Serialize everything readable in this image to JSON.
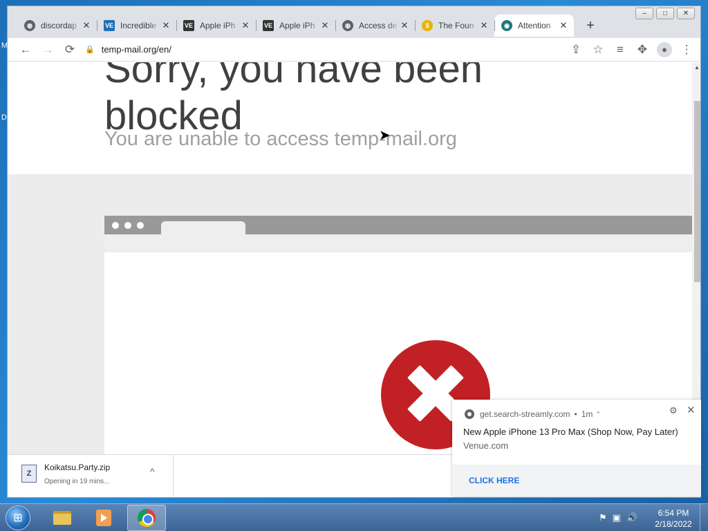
{
  "desktop": {
    "edge_letters": [
      "M",
      "D"
    ]
  },
  "window": {
    "controls": [
      "–",
      "□",
      "✕"
    ]
  },
  "tabs": [
    {
      "title": "discordap",
      "favicon": "globe-icon",
      "active": false
    },
    {
      "title": "Incredible",
      "favicon": "ve-icon",
      "active": false
    },
    {
      "title": "Apple iPh",
      "favicon": "ve-icon",
      "active": false
    },
    {
      "title": "Apple iPh",
      "favicon": "ve-icon",
      "active": false
    },
    {
      "title": "Access de",
      "favicon": "globe-icon",
      "active": false
    },
    {
      "title": "The Foun",
      "favicon": "yellow-icon",
      "active": false
    },
    {
      "title": "Attention",
      "favicon": "teal-icon",
      "active": true
    }
  ],
  "newtab_label": "+",
  "toolbar": {
    "back": "←",
    "forward": "→",
    "reload": "⟳",
    "url": "temp-mail.org/en/",
    "lock": "🔒",
    "share": "⇪",
    "star": "☆",
    "media": "≡",
    "extensions": "✥",
    "profile": "●",
    "menu": "⋮"
  },
  "page": {
    "heading": "Sorry, you have been blocked",
    "subheading": "You are unable to access temp-mail.org"
  },
  "download": {
    "filename": "Koikatsu.Party.zip",
    "status": "Opening in 19 mins...",
    "icon_letter": "Z",
    "chevron": "^"
  },
  "notification": {
    "origin": "get.search-streamly.com",
    "time": "1m",
    "title": "New Apple iPhone 13 Pro Max (Shop Now, Pay Later)",
    "body": "Venue.com",
    "action": "CLICK HERE",
    "gear": "⚙",
    "close": "✕"
  },
  "taskbar": {
    "start": "⊞",
    "clock_time": "6:54 PM",
    "clock_date": "2/18/2022",
    "tray_icons": [
      "flag-icon",
      "network-icon",
      "volume-icon"
    ]
  }
}
